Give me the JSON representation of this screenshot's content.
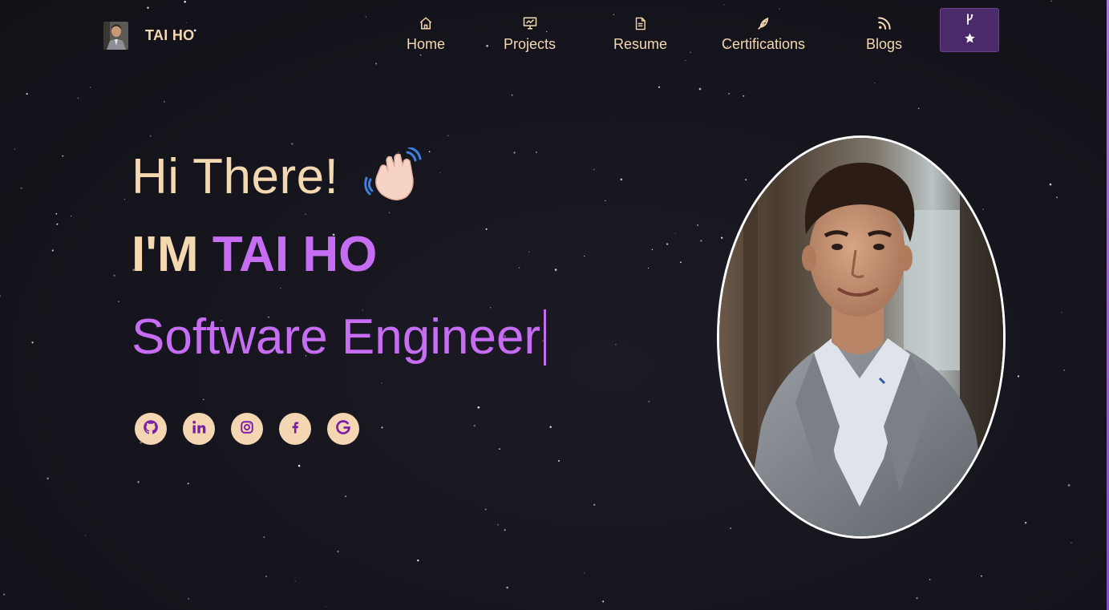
{
  "navbar": {
    "brand_name": "TAI HO",
    "items": [
      {
        "label": "Home",
        "icon": "home-icon"
      },
      {
        "label": "Projects",
        "icon": "presentation-icon"
      },
      {
        "label": "Resume",
        "icon": "document-icon"
      },
      {
        "label": "Certifications",
        "icon": "feather-pen-icon"
      },
      {
        "label": "Blogs",
        "icon": "rss-icon"
      }
    ],
    "fork_button": {
      "icons": [
        "git-fork-icon",
        "star-icon"
      ]
    }
  },
  "hero": {
    "greeting": "Hi There!",
    "intro_prefix": "I'M ",
    "name": "TAI HO",
    "role": "Software Engineer"
  },
  "socials": [
    {
      "icon": "github-icon"
    },
    {
      "icon": "linkedin-icon"
    },
    {
      "icon": "instagram-icon"
    },
    {
      "icon": "facebook-icon"
    },
    {
      "icon": "google-icon"
    }
  ],
  "colors": {
    "background": "#15141c",
    "accent_peach": "#f3d8b0",
    "accent_purple": "#c66df3",
    "fork_button": "#4a2a68",
    "social_bg": "#f5d6b2",
    "social_icon": "#7a1fa8"
  }
}
